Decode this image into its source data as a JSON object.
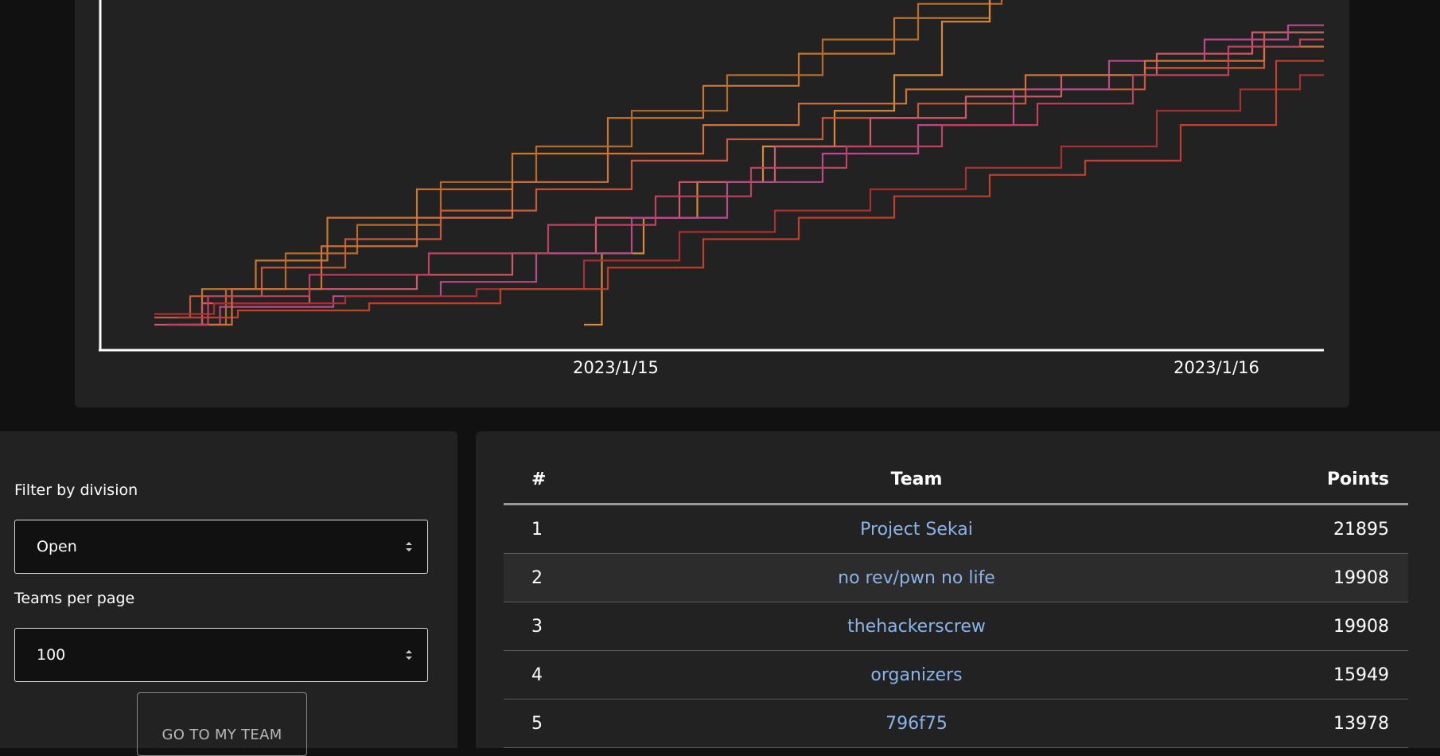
{
  "chart_data": {
    "type": "line",
    "x_axis": {
      "type": "time",
      "tick_labels": [
        "2023/1/15",
        "2023/1/16"
      ]
    },
    "series": [
      {
        "color": "#c8782e",
        "points": [
          [
            0.04,
            0.0
          ],
          [
            0.08,
            0.1
          ],
          [
            0.13,
            0.18
          ],
          [
            0.2,
            0.3
          ],
          [
            0.28,
            0.38
          ],
          [
            0.36,
            0.48
          ],
          [
            0.44,
            0.58
          ],
          [
            0.52,
            0.67
          ],
          [
            0.6,
            0.76
          ],
          [
            0.68,
            0.86
          ],
          [
            0.76,
            0.94
          ],
          [
            0.8,
            1.0
          ]
        ]
      },
      {
        "color": "#b86a28",
        "points": [
          [
            0.06,
            0.0
          ],
          [
            0.1,
            0.1
          ],
          [
            0.16,
            0.2
          ],
          [
            0.22,
            0.28
          ],
          [
            0.3,
            0.4
          ],
          [
            0.38,
            0.5
          ],
          [
            0.46,
            0.6
          ],
          [
            0.54,
            0.7
          ],
          [
            0.62,
            0.8
          ],
          [
            0.7,
            0.9
          ],
          [
            0.76,
            1.0
          ]
        ]
      },
      {
        "color": "#d68a3a",
        "points": [
          [
            0.38,
            0.0
          ],
          [
            0.41,
            0.2
          ],
          [
            0.45,
            0.3
          ],
          [
            0.5,
            0.4
          ],
          [
            0.56,
            0.5
          ],
          [
            0.62,
            0.6
          ],
          [
            0.66,
            0.7
          ],
          [
            0.7,
            0.85
          ],
          [
            0.74,
            1.0
          ]
        ]
      },
      {
        "color": "#c85a3a",
        "points": [
          [
            0.02,
            0.02
          ],
          [
            0.08,
            0.08
          ],
          [
            0.14,
            0.16
          ],
          [
            0.22,
            0.24
          ],
          [
            0.3,
            0.32
          ],
          [
            0.38,
            0.38
          ],
          [
            0.46,
            0.46
          ],
          [
            0.54,
            0.52
          ],
          [
            0.62,
            0.58
          ],
          [
            0.7,
            0.62
          ],
          [
            0.8,
            0.66
          ],
          [
            0.9,
            0.72
          ],
          [
            1.0,
            0.82
          ]
        ]
      },
      {
        "color": "#d05a6a",
        "points": [
          [
            0.02,
            0.0
          ],
          [
            0.1,
            0.06
          ],
          [
            0.2,
            0.1
          ],
          [
            0.28,
            0.14
          ],
          [
            0.36,
            0.2
          ],
          [
            0.42,
            0.3
          ],
          [
            0.5,
            0.4
          ],
          [
            0.58,
            0.5
          ],
          [
            0.66,
            0.58
          ],
          [
            0.74,
            0.64
          ],
          [
            0.82,
            0.7
          ],
          [
            0.9,
            0.76
          ],
          [
            0.98,
            0.82
          ],
          [
            1.0,
            0.82
          ]
        ]
      },
      {
        "color": "#b84a8a",
        "points": [
          [
            0.03,
            0.0
          ],
          [
            0.12,
            0.05
          ],
          [
            0.22,
            0.08
          ],
          [
            0.3,
            0.12
          ],
          [
            0.38,
            0.2
          ],
          [
            0.46,
            0.3
          ],
          [
            0.54,
            0.4
          ],
          [
            0.62,
            0.48
          ],
          [
            0.7,
            0.56
          ],
          [
            0.78,
            0.66
          ],
          [
            0.86,
            0.74
          ],
          [
            0.94,
            0.8
          ],
          [
            1.0,
            0.84
          ]
        ]
      },
      {
        "color": "#a83030",
        "points": [
          [
            0.02,
            0.03
          ],
          [
            0.12,
            0.06
          ],
          [
            0.24,
            0.08
          ],
          [
            0.34,
            0.1
          ],
          [
            0.42,
            0.18
          ],
          [
            0.5,
            0.26
          ],
          [
            0.58,
            0.32
          ],
          [
            0.66,
            0.38
          ],
          [
            0.74,
            0.44
          ],
          [
            0.82,
            0.5
          ],
          [
            0.9,
            0.6
          ],
          [
            0.96,
            0.66
          ],
          [
            1.0,
            0.7
          ]
        ]
      },
      {
        "color": "#c0402a",
        "points": [
          [
            0.04,
            0.02
          ],
          [
            0.14,
            0.04
          ],
          [
            0.26,
            0.06
          ],
          [
            0.36,
            0.1
          ],
          [
            0.44,
            0.16
          ],
          [
            0.52,
            0.24
          ],
          [
            0.6,
            0.3
          ],
          [
            0.68,
            0.36
          ],
          [
            0.76,
            0.42
          ],
          [
            0.84,
            0.46
          ],
          [
            0.92,
            0.56
          ],
          [
            1.0,
            0.74
          ]
        ]
      },
      {
        "color": "#d4703a",
        "points": [
          [
            0.05,
            0.0
          ],
          [
            0.12,
            0.1
          ],
          [
            0.2,
            0.22
          ],
          [
            0.28,
            0.3
          ],
          [
            0.36,
            0.4
          ],
          [
            0.44,
            0.48
          ],
          [
            0.52,
            0.56
          ],
          [
            0.6,
            0.62
          ],
          [
            0.7,
            0.66
          ],
          [
            0.8,
            0.7
          ],
          [
            0.9,
            0.74
          ],
          [
            1.0,
            0.78
          ]
        ]
      },
      {
        "color": "#c04060",
        "points": [
          [
            0.03,
            0.0
          ],
          [
            0.1,
            0.08
          ],
          [
            0.2,
            0.14
          ],
          [
            0.3,
            0.2
          ],
          [
            0.4,
            0.28
          ],
          [
            0.48,
            0.36
          ],
          [
            0.56,
            0.44
          ],
          [
            0.64,
            0.5
          ],
          [
            0.72,
            0.56
          ],
          [
            0.8,
            0.62
          ],
          [
            0.88,
            0.7
          ],
          [
            0.96,
            0.78
          ],
          [
            1.0,
            0.8
          ]
        ]
      }
    ]
  },
  "filters": {
    "division_label": "Filter by division",
    "division_value": "Open",
    "per_page_label": "Teams per page",
    "per_page_value": "100",
    "goto_button": "GO TO MY TEAM"
  },
  "scoreboard": {
    "headers": {
      "rank": "#",
      "team": "Team",
      "points": "Points"
    },
    "rows": [
      {
        "rank": "1",
        "team": "Project Sekai",
        "points": "21895"
      },
      {
        "rank": "2",
        "team": "no rev/pwn no life",
        "points": "19908"
      },
      {
        "rank": "3",
        "team": "thehackerscrew",
        "points": "19908"
      },
      {
        "rank": "4",
        "team": "organizers",
        "points": "15949"
      },
      {
        "rank": "5",
        "team": "796f75",
        "points": "13978"
      }
    ]
  }
}
